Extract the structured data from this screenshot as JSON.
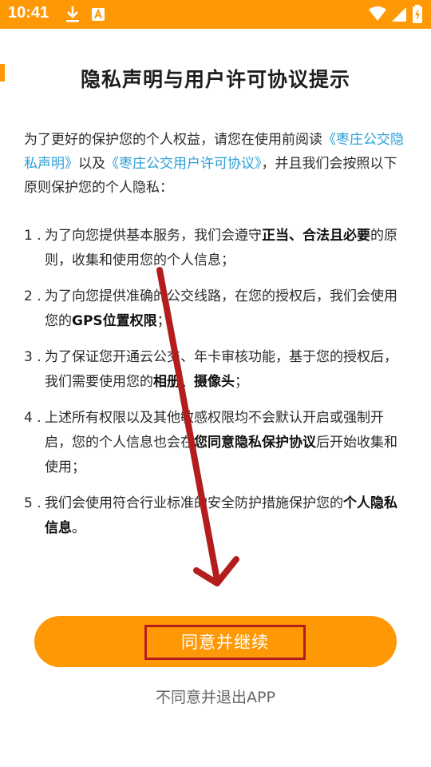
{
  "status_bar": {
    "time": "10:41",
    "icons": [
      "download-icon",
      "a-notification-icon",
      "wifi-icon",
      "cellular-signal-icon",
      "battery-icon"
    ],
    "background": "#ff9805"
  },
  "dialog": {
    "title": "隐私声明与用户许可协议提示",
    "intro": {
      "text_1": "为了更好的保护您的个人权益，请您在使用前阅读",
      "privacy_link": "《枣庄公交隐私声明》",
      "text_2": "以及",
      "license_link": "《枣庄公交用户许可协议》",
      "text_3": "，并且我们会按照以下原则保护您的个人隐私："
    },
    "principles": [
      {
        "num": "1 .",
        "pre": "为了向您提供基本服务，我们会遵守",
        "bold": "正当、合法且必要",
        "post": "的原则，收集和使用您的个人信息；"
      },
      {
        "num": "2 .",
        "pre": "为了向您提供准确的公交线路，在您的授权后，我们会使用您的",
        "bold": "GPS位置权限",
        "post": "；"
      },
      {
        "num": "3 .",
        "pre": "为了保证您开通云公交、年卡审核功能，基于您的授权后，我们需要使用您的",
        "bold": "相册、摄像头",
        "post": "；"
      },
      {
        "num": "4 .",
        "pre": "上述所有权限以及其他敏感权限均不会默认开启或强制开启，您的个人信息也会在",
        "bold": "您同意隐私保护协议",
        "post": "后开始收集和使用；"
      },
      {
        "num": "5 .",
        "pre": "我们会使用符合行业标准的安全防护措施保护您的",
        "bold": "个人隐私信息",
        "post": "。"
      }
    ],
    "agree_label": "同意并继续",
    "exit_label": "不同意并退出APP"
  },
  "colors": {
    "accent": "#ff9805",
    "link": "#2a9fd6",
    "annotation": "#b31d1d"
  }
}
